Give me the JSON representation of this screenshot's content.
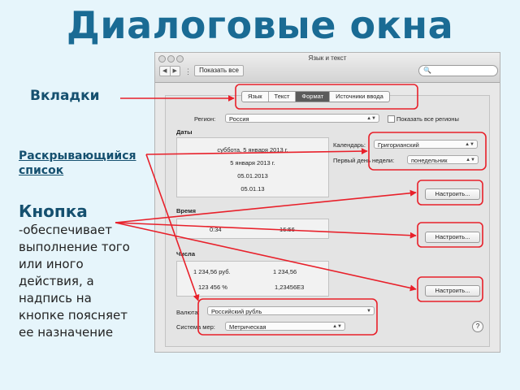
{
  "slide": {
    "title": "Диалоговые окна",
    "label_tabs": "Вкладки",
    "label_dropdown": "Раскрывающийся список",
    "label_button": "Кнопка",
    "button_description": "-обеспечивает выполнение того или иного действия, а надпись на кнопке поясняет ее назначение"
  },
  "window": {
    "title": "Язык и текст",
    "nav_back": "◀",
    "nav_forward": "▶",
    "grid_icon": "⋮⋮⋮",
    "show_all": "Показать все",
    "search_placeholder": "",
    "search_icon": "🔍"
  },
  "tabs": [
    "Язык",
    "Текст",
    "Формат",
    "Источники ввода"
  ],
  "active_tab": 2,
  "region": {
    "label": "Регион:",
    "value": "Россия",
    "show_all_label": "Показать все регионы",
    "show_all_checked": false
  },
  "dates": {
    "heading": "Даты",
    "samples": [
      "суббота, 5 января 2013 г.",
      "5 января 2013 г.",
      "05.01.2013",
      "05.01.13"
    ],
    "calendar_label": "Календарь:",
    "calendar_value": "Григорианский",
    "first_day_label": "Первый день недели:",
    "first_day_value": "понедельник",
    "customize": "Настроить..."
  },
  "time": {
    "heading": "Время",
    "samples": [
      "0:34",
      "16:56"
    ],
    "customize": "Настроить..."
  },
  "numbers": {
    "heading": "Числа",
    "samples": [
      "1 234,56 руб.",
      "1 234,56",
      "123 456 %",
      "1,23456E3"
    ],
    "customize": "Настроить..."
  },
  "currency": {
    "label": "Валюта:",
    "value": "Российский рубль"
  },
  "measure": {
    "label": "Система мер:",
    "value": "Метрическая"
  },
  "help": "?",
  "colors": {
    "title": "#1a6b94",
    "label": "#15506f",
    "highlight": "#e8202a",
    "background": "#e6f5fb"
  }
}
